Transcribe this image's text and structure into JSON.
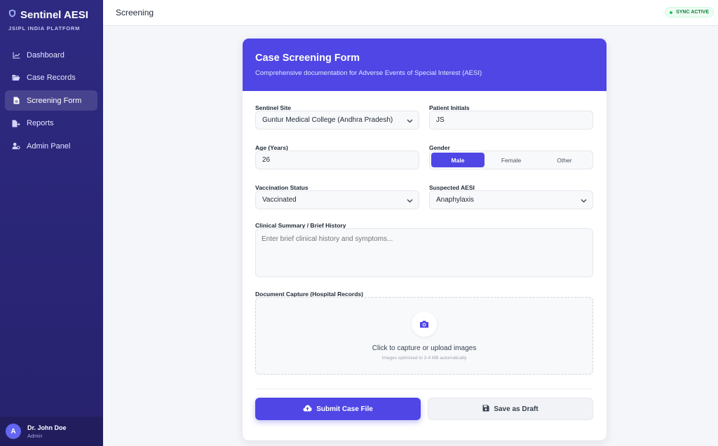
{
  "brand": {
    "title": "Sentinel AESI",
    "subtitle": "JSIPL INDIA PLATFORM"
  },
  "nav": [
    {
      "label": "Dashboard",
      "icon": "chart-line-icon",
      "active": false
    },
    {
      "label": "Case Records",
      "icon": "folder-open-icon",
      "active": false
    },
    {
      "label": "Screening Form",
      "icon": "file-icon",
      "active": true
    },
    {
      "label": "Reports",
      "icon": "file-export-icon",
      "active": false
    },
    {
      "label": "Admin Panel",
      "icon": "user-gear-icon",
      "active": false
    }
  ],
  "user": {
    "initial": "A",
    "name": "Dr. John Doe",
    "role": "Admin"
  },
  "topbar": {
    "title": "Screening",
    "sync": "SYNC ACTIVE"
  },
  "form": {
    "title": "Case Screening Form",
    "subtitle": "Comprehensive documentation for Adverse Events of Special Interest (AESI)",
    "site": {
      "label": "Sentinel Site",
      "value": "Guntur Medical College (Andhra Pradesh)"
    },
    "initials": {
      "label": "Patient Initials",
      "value": "JS"
    },
    "age": {
      "label": "Age (Years)",
      "value": "26"
    },
    "gender": {
      "label": "Gender",
      "options": [
        "Male",
        "Female",
        "Other"
      ],
      "selected": "Male"
    },
    "vaccination": {
      "label": "Vaccination Status",
      "value": "Vaccinated"
    },
    "aesi": {
      "label": "Suspected AESI",
      "value": "Anaphylaxis"
    },
    "summary": {
      "label": "Clinical Summary / Brief History",
      "placeholder": "Enter brief clinical history and symptoms..."
    },
    "capture": {
      "label": "Document Capture (Hospital Records)",
      "main": "Click to capture or upload images",
      "sub": "Images optimized to 2-4 MB automatically"
    },
    "submit_label": "Submit Case File",
    "draft_label": "Save as Draft"
  },
  "colors": {
    "primary": "#4f46e5",
    "sidebar": "#2e2a82",
    "sync": "#15803d"
  }
}
